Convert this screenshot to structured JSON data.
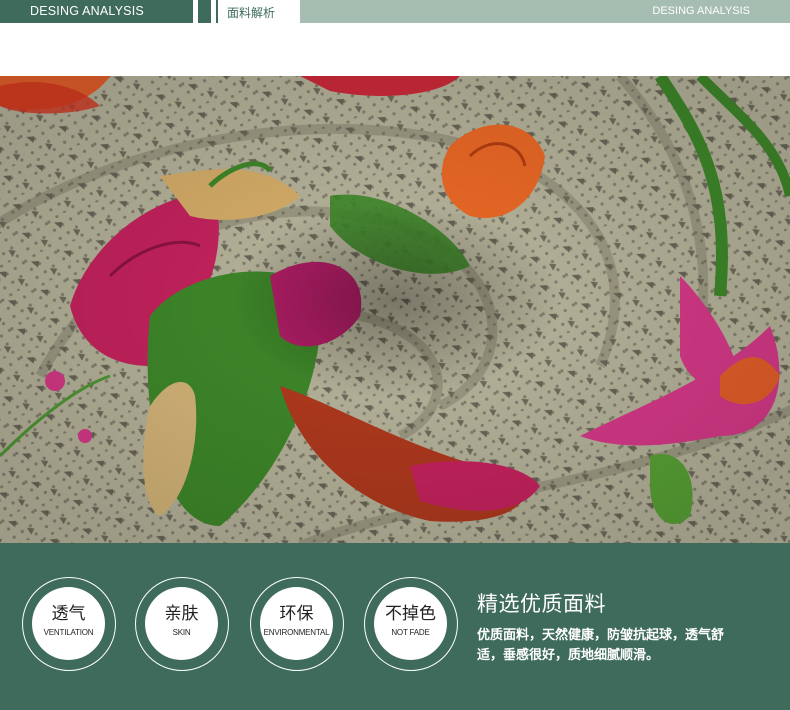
{
  "header": {
    "left_label": "DESING ANALYSIS",
    "tab_label": "面料解析",
    "right_label": "DESING ANALYSIS"
  },
  "photo": {
    "subject": "floral printed silky fabric swirl",
    "colors": {
      "base": "#b7b49b",
      "dots": "#4a463c",
      "pink": "#d02a6a",
      "orange": "#e8602a",
      "green": "#3f8a2a",
      "tan": "#d8b87a"
    }
  },
  "features": {
    "badges": [
      {
        "cn": "透气",
        "en": "VENTILATION"
      },
      {
        "cn": "亲肤",
        "en": "SKIN"
      },
      {
        "cn": "环保",
        "en": "ENVIRONMENTAL"
      },
      {
        "cn": "不掉色",
        "en": "NOT FADE"
      }
    ],
    "title": "精选优质面料",
    "description": "优质面料，天然健康，防皱抗起球，透气舒适，垂感很好，质地细腻顺滑。"
  },
  "theme": {
    "primary": "#3f6b5c",
    "light": "#a6bdb2"
  }
}
